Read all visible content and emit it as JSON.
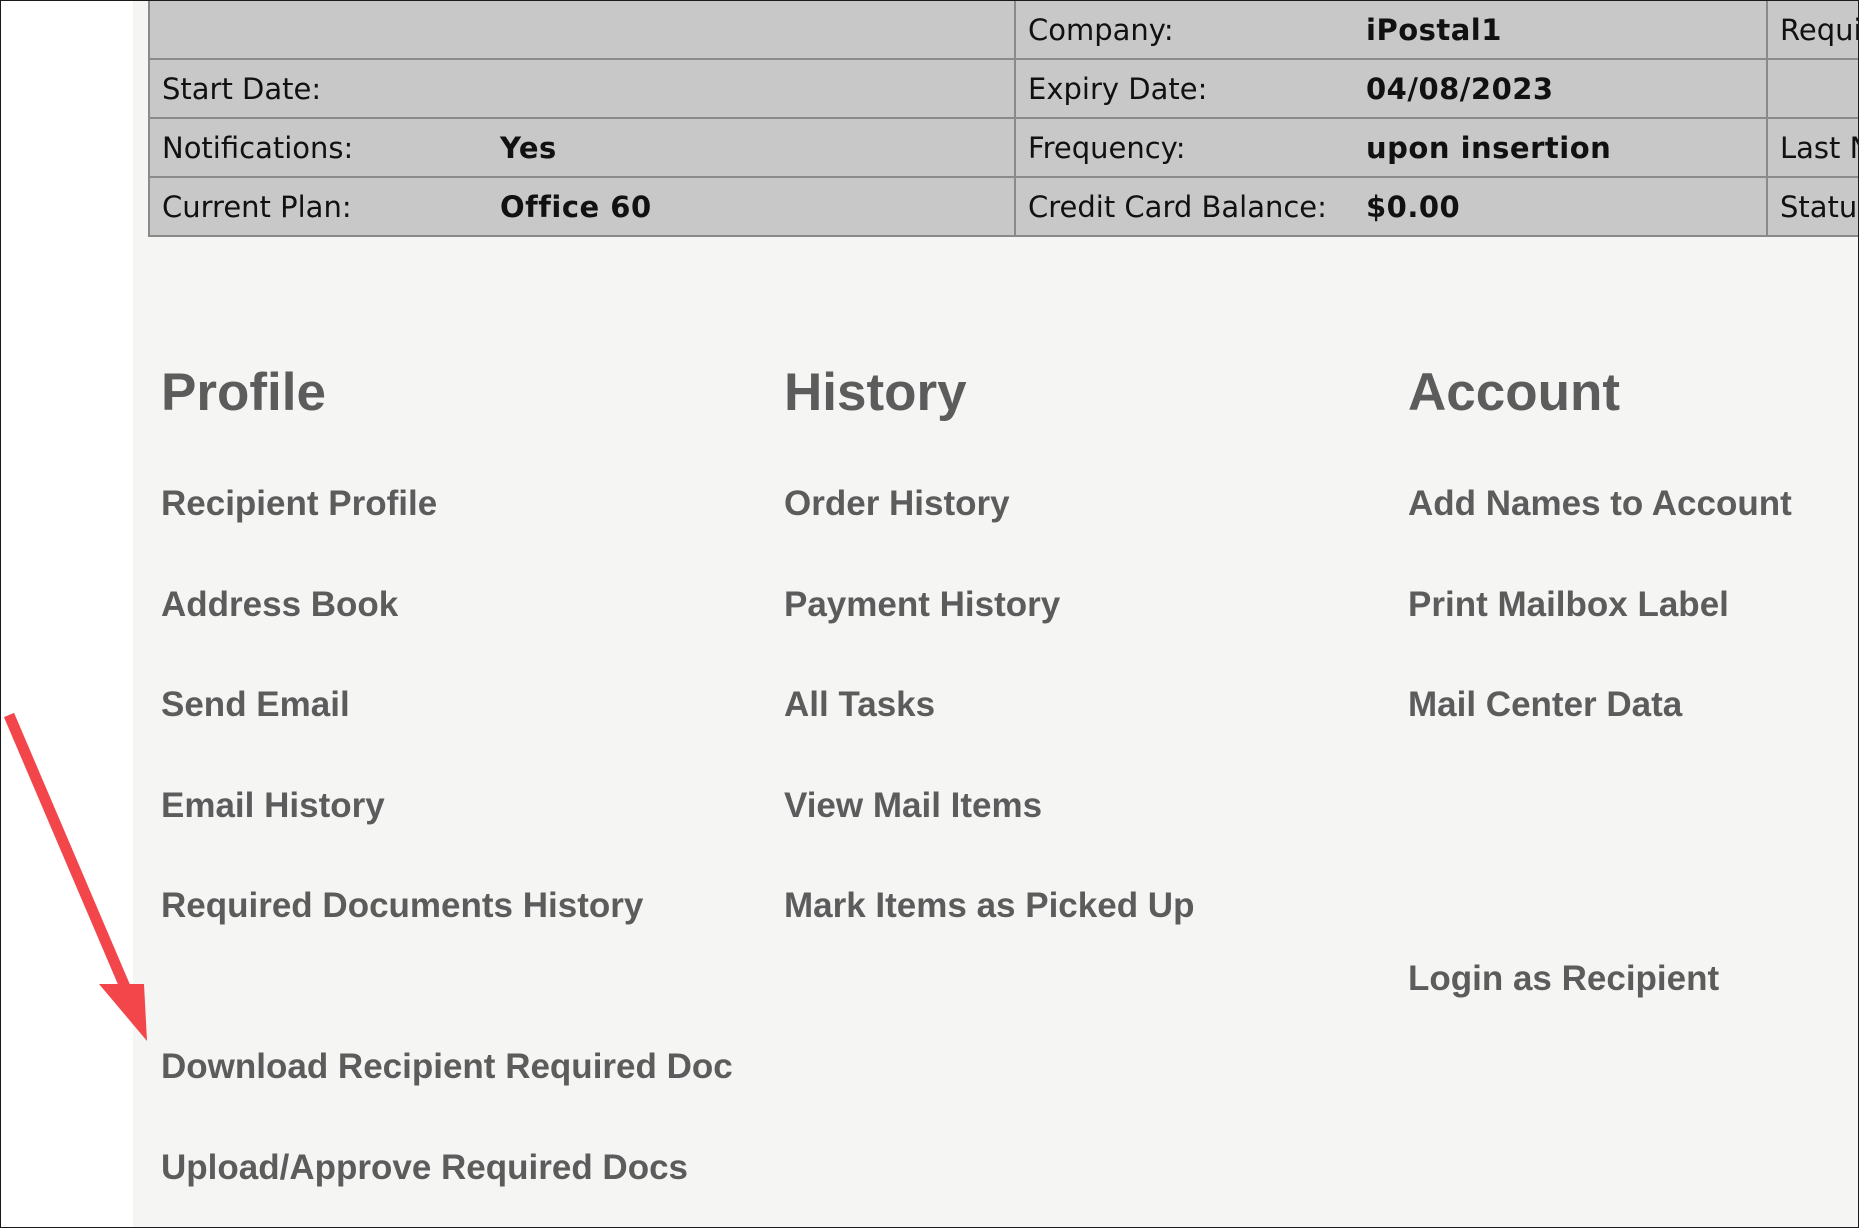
{
  "account_info": {
    "rows": [
      {
        "left_label": "",
        "left_value": "",
        "mid_label": "Company:",
        "mid_value": "iPostal1",
        "right_label": "Requi"
      },
      {
        "left_label": "Start Date:",
        "left_value": "",
        "mid_label": "Expiry Date:",
        "mid_value": "04/08/2023",
        "right_label": ""
      },
      {
        "left_label": "Notifications:",
        "left_value": "Yes",
        "mid_label": "Frequency:",
        "mid_value": "upon insertion",
        "right_label": "Last N"
      },
      {
        "left_label": "Current Plan:",
        "left_value": "Office 60",
        "mid_label": "Credit Card Balance:",
        "mid_value": "$0.00",
        "right_label": "Status"
      }
    ]
  },
  "sections": {
    "profile": {
      "heading": "Profile",
      "links": [
        "Recipient Profile",
        "Address Book",
        "Send Email",
        "Email History",
        "Required Documents History",
        "Download Recipient Required Doc",
        "Upload/Approve Required Docs"
      ]
    },
    "history": {
      "heading": "History",
      "links": [
        "Order History",
        "Payment History",
        "All Tasks",
        "View Mail Items",
        "Mark Items as Picked Up"
      ]
    },
    "account": {
      "heading": "Account",
      "links": [
        "Add Names to Account",
        "Print Mailbox Label",
        "Mail Center Data",
        "Login as Recipient"
      ]
    }
  },
  "colors": {
    "table_bg": "#c8c8c8",
    "table_border": "#8a8a8a",
    "page_bg": "#f5f5f4",
    "link_text": "#5c5c5c",
    "annotation_arrow": "#f2464b"
  }
}
